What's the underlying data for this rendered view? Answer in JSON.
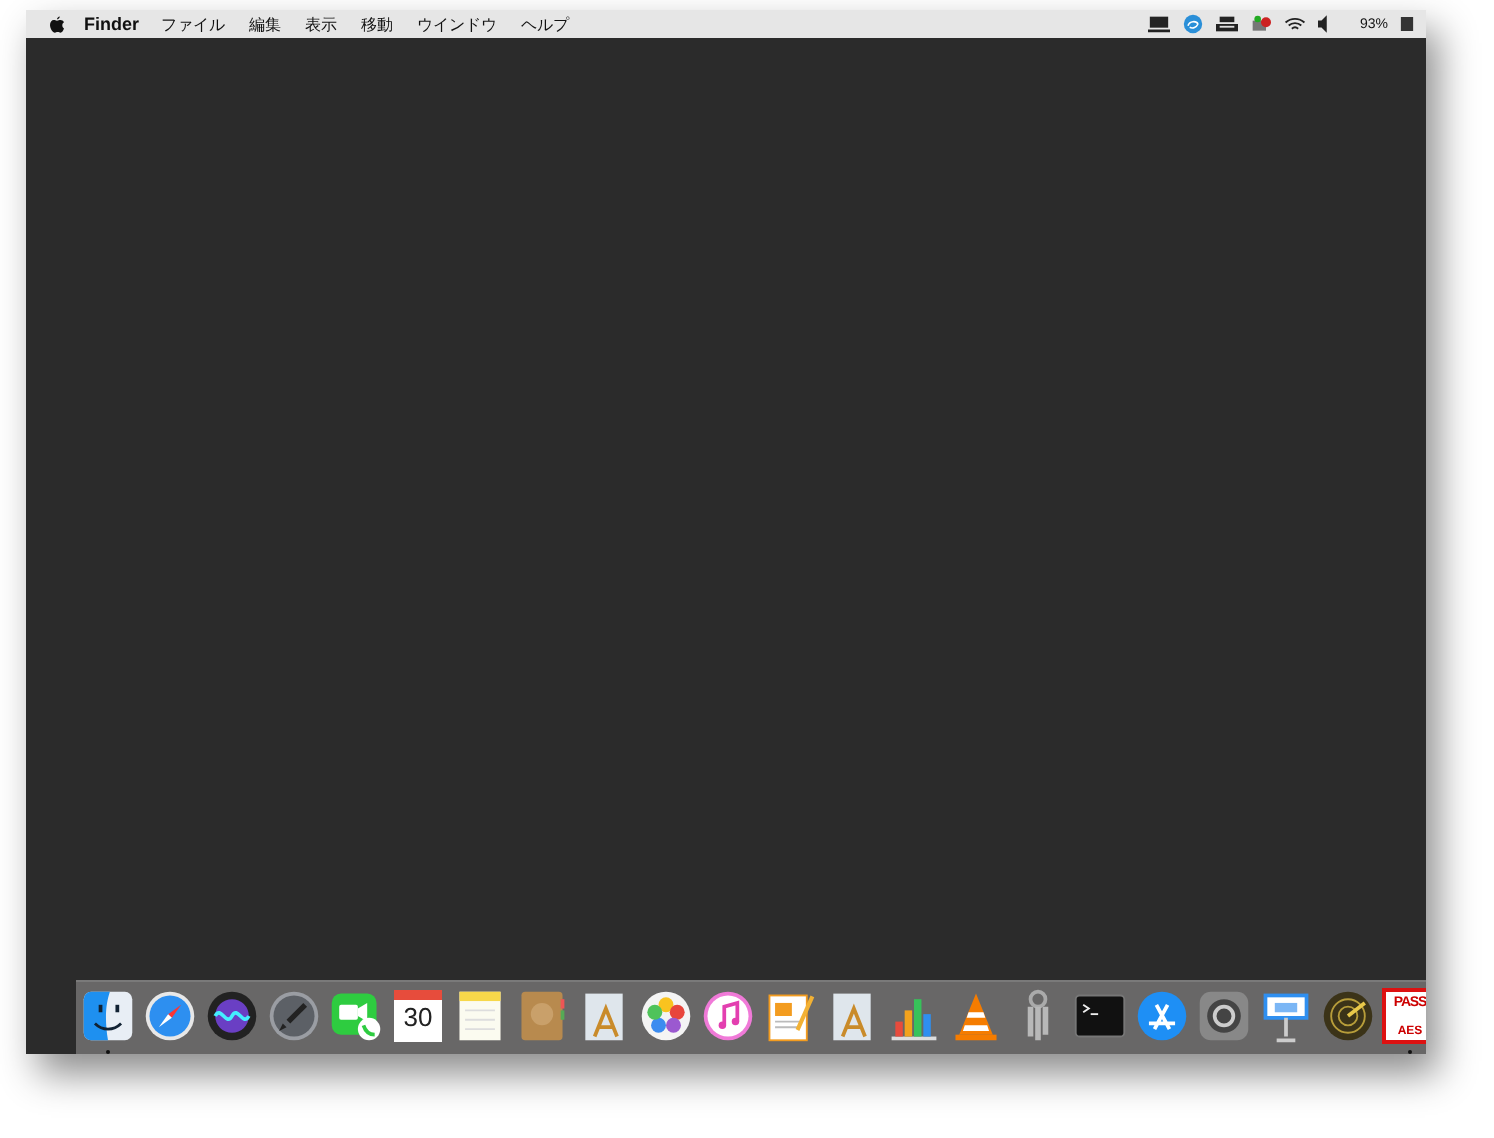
{
  "menu_bar": {
    "app_name": "Finder",
    "menus": [
      "ファイル",
      "編集",
      "表示",
      "移動",
      "ウインドウ",
      "ヘルプ"
    ],
    "battery_percent": "93%"
  },
  "dock": {
    "items": [
      {
        "kind": "finder",
        "running": true
      },
      {
        "kind": "safari",
        "running": false
      },
      {
        "kind": "siri",
        "running": false
      },
      {
        "kind": "launchpad",
        "running": false
      },
      {
        "kind": "facetime",
        "running": false
      },
      {
        "kind": "calendar",
        "running": false,
        "day": "30"
      },
      {
        "kind": "notes",
        "running": false
      },
      {
        "kind": "contacts",
        "running": false
      },
      {
        "kind": "textedit",
        "running": false
      },
      {
        "kind": "photos",
        "running": false
      },
      {
        "kind": "music",
        "running": false
      },
      {
        "kind": "pages",
        "running": false
      },
      {
        "kind": "textedit",
        "running": false
      },
      {
        "kind": "numbers",
        "running": false
      },
      {
        "kind": "vlc",
        "running": false
      },
      {
        "kind": "keychain",
        "running": false
      },
      {
        "kind": "terminal",
        "running": false
      },
      {
        "kind": "appstore",
        "running": false
      },
      {
        "kind": "settings",
        "running": false
      },
      {
        "kind": "keynote",
        "running": false
      },
      {
        "kind": "radar",
        "running": false
      },
      {
        "kind": "pass",
        "running": true,
        "top": "PASS",
        "bottom": "AES"
      }
    ]
  }
}
